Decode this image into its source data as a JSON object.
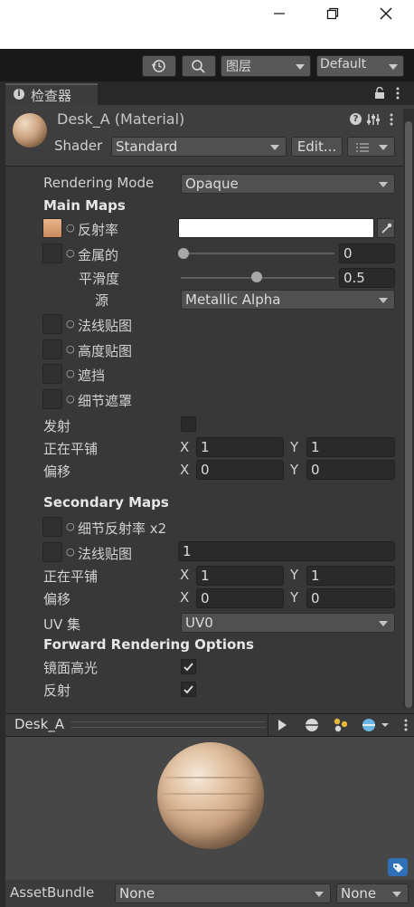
{
  "window": {
    "minimize_icon": "minimize-icon",
    "maximize_icon": "maximize-icon",
    "close_icon": "close-icon"
  },
  "toolbar": {
    "layers_label": "图层",
    "layout_label": "Default"
  },
  "tab": {
    "title": "检查器"
  },
  "material": {
    "name": "Desk_A (Material)",
    "shader_label": "Shader",
    "shader_value": "Standard",
    "edit_label": "Edit..."
  },
  "props": {
    "rendering_mode_label": "Rendering Mode",
    "rendering_mode_value": "Opaque",
    "main_maps": "Main Maps",
    "albedo": "反射率",
    "metallic": "金属的",
    "metallic_value": "0",
    "smoothness": "平滑度",
    "smoothness_value": "0.5",
    "source": "源",
    "source_value": "Metallic Alpha",
    "normal": "法线贴图",
    "height": "高度贴图",
    "occlusion": "遮挡",
    "detail_mask": "细节遮罩",
    "emission": "发射",
    "tiling": "正在平铺",
    "offset": "偏移",
    "x": "X",
    "y": "Y",
    "tx": "1",
    "ty": "1",
    "ox": "0",
    "oy": "0",
    "secondary_maps": "Secondary Maps",
    "detail_albedo": "细节反射率 x2",
    "sec_normal": "法线贴图",
    "sec_normal_value": "1",
    "stx": "1",
    "sty": "1",
    "sox": "0",
    "soy": "0",
    "uv_label": "UV 集",
    "uv_value": "UV0",
    "forward": "Forward Rendering Options",
    "specular": "镜面高光",
    "reflections": "反射"
  },
  "preview": {
    "name": "Desk_A"
  },
  "assetbundle": {
    "label": "AssetBundle",
    "value1": "None",
    "value2": "None"
  },
  "colors": {
    "accent": "#4a8fd6",
    "albedo": "#ffffff"
  }
}
